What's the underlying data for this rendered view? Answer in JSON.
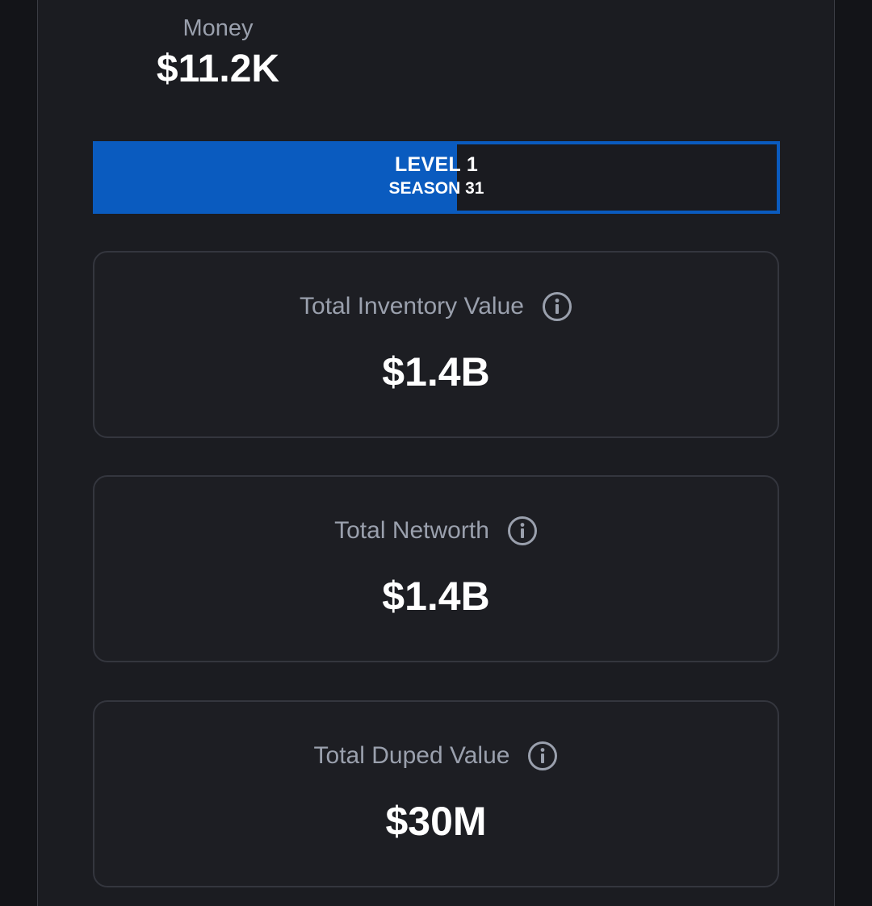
{
  "money": {
    "label": "Money",
    "value": "$11.2K"
  },
  "level_bar": {
    "level_label": "LEVEL 1",
    "season_label": "SEASON 31",
    "progress_fraction": 0.53,
    "fill_color": "#0a5bbf"
  },
  "stats": [
    {
      "title": "Total Inventory Value",
      "value": "$1.4B",
      "icon": "info-icon"
    },
    {
      "title": "Total Networth",
      "value": "$1.4B",
      "icon": "info-icon"
    },
    {
      "title": "Total Duped Value",
      "value": "$30M",
      "icon": "info-icon"
    }
  ],
  "colors": {
    "background": "#131418",
    "panel": "#1b1c21",
    "accent": "#0a5bbf",
    "muted_text": "#9aa0ad"
  }
}
